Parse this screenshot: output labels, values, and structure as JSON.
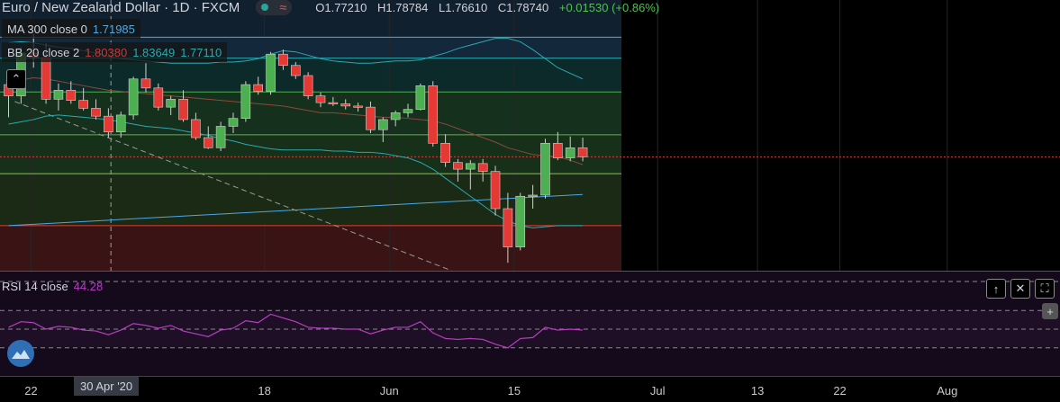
{
  "header": {
    "title": "Euro / New Zealand Dollar · 1D · FXCM",
    "ohlc": {
      "open": "O1.77210",
      "high": "H1.78784",
      "low": "L1.76610",
      "close": "C1.78740",
      "change": "+0.01530 (+0.86%)"
    },
    "flag_icon": "≈"
  },
  "indicators": {
    "ma": {
      "name": "MA 300 close 0",
      "value": "1.71985",
      "color": "#4aa8e8"
    },
    "bb": {
      "name": "BB 20 close 2",
      "upper": "1.80380",
      "middle": "1.83649",
      "lower": "1.77110",
      "colors": [
        "#c43b3b",
        "#2aa9b0",
        "#2aa9b0"
      ]
    },
    "rsi": {
      "name": "RSI 14 close",
      "value": "44.28",
      "color": "#b53fc0"
    }
  },
  "crosshair_date": "30 Apr '20",
  "chart_data": {
    "type": "candlestick",
    "candles": [
      [
        1.785,
        1.792,
        1.756,
        1.775
      ],
      [
        1.775,
        1.818,
        1.768,
        1.813
      ],
      [
        1.813,
        1.83,
        1.8,
        1.809
      ],
      [
        1.809,
        1.822,
        1.768,
        1.772
      ],
      [
        1.772,
        1.786,
        1.762,
        1.78
      ],
      [
        1.78,
        1.788,
        1.768,
        1.771
      ],
      [
        1.771,
        1.782,
        1.762,
        1.764
      ],
      [
        1.764,
        1.772,
        1.754,
        1.757
      ],
      [
        1.757,
        1.764,
        1.738,
        1.743
      ],
      [
        1.743,
        1.761,
        1.738,
        1.758
      ],
      [
        1.758,
        1.792,
        1.754,
        1.79
      ],
      [
        1.79,
        1.804,
        1.778,
        1.782
      ],
      [
        1.782,
        1.786,
        1.762,
        1.765
      ],
      [
        1.765,
        1.775,
        1.758,
        1.772
      ],
      [
        1.772,
        1.78,
        1.752,
        1.754
      ],
      [
        1.754,
        1.76,
        1.736,
        1.738
      ],
      [
        1.738,
        1.748,
        1.728,
        1.729
      ],
      [
        1.729,
        1.752,
        1.726,
        1.748
      ],
      [
        1.748,
        1.76,
        1.742,
        1.755
      ],
      [
        1.755,
        1.788,
        1.752,
        1.785
      ],
      [
        1.785,
        1.792,
        1.776,
        1.779
      ],
      [
        1.779,
        1.814,
        1.776,
        1.812
      ],
      [
        1.812,
        1.816,
        1.798,
        1.802
      ],
      [
        1.802,
        1.805,
        1.79,
        1.793
      ],
      [
        1.793,
        1.796,
        1.772,
        1.775
      ],
      [
        1.775,
        1.778,
        1.765,
        1.769
      ],
      [
        1.769,
        1.774,
        1.766,
        1.768
      ],
      [
        1.768,
        1.772,
        1.763,
        1.766
      ],
      [
        1.766,
        1.769,
        1.761,
        1.765
      ],
      [
        1.765,
        1.77,
        1.742,
        1.745
      ],
      [
        1.745,
        1.756,
        1.734,
        1.754
      ],
      [
        1.754,
        1.762,
        1.748,
        1.76
      ],
      [
        1.76,
        1.768,
        1.756,
        1.763
      ],
      [
        1.763,
        1.786,
        1.762,
        1.784
      ],
      [
        1.784,
        1.788,
        1.73,
        1.733
      ],
      [
        1.733,
        1.741,
        1.712,
        1.716
      ],
      [
        1.716,
        1.719,
        1.699,
        1.71
      ],
      [
        1.71,
        1.718,
        1.692,
        1.715
      ],
      [
        1.715,
        1.719,
        1.699,
        1.708
      ],
      [
        1.708,
        1.713,
        1.669,
        1.675
      ],
      [
        1.675,
        1.689,
        1.627,
        1.641
      ],
      [
        1.641,
        1.689,
        1.638,
        1.686
      ],
      [
        1.686,
        1.696,
        1.675,
        1.687
      ],
      [
        1.687,
        1.737,
        1.684,
        1.733
      ],
      [
        1.733,
        1.743,
        1.718,
        1.72
      ],
      [
        1.72,
        1.739,
        1.717,
        1.729
      ],
      [
        1.729,
        1.738,
        1.717,
        1.721
      ]
    ],
    "bb_upper": [
      1.822,
      1.823,
      1.822,
      1.82,
      1.818,
      1.817,
      1.815,
      1.813,
      1.81,
      1.808,
      1.807,
      1.806,
      1.805,
      1.804,
      1.804,
      1.804,
      1.804,
      1.805,
      1.805,
      1.806,
      1.808,
      1.812,
      1.815,
      1.814,
      1.811,
      1.808,
      1.806,
      1.805,
      1.804,
      1.804,
      1.805,
      1.806,
      1.806,
      1.807,
      1.81,
      1.813,
      1.817,
      1.82,
      1.823,
      1.826,
      1.826,
      1.823,
      1.816,
      1.808,
      1.8,
      1.795,
      1.79
    ],
    "bb_middle": [
      1.786,
      1.789,
      1.791,
      1.79,
      1.788,
      1.786,
      1.784,
      1.782,
      1.78,
      1.779,
      1.778,
      1.777,
      1.776,
      1.775,
      1.774,
      1.773,
      1.772,
      1.771,
      1.77,
      1.769,
      1.768,
      1.767,
      1.766,
      1.764,
      1.762,
      1.76,
      1.76,
      1.759,
      1.758,
      1.757,
      1.756,
      1.756,
      1.755,
      1.754,
      1.753,
      1.75,
      1.746,
      1.742,
      1.738,
      1.734,
      1.729,
      1.726,
      1.723,
      1.722,
      1.721,
      1.718,
      1.714
    ],
    "bb_lower": [
      1.75,
      1.752,
      1.754,
      1.757,
      1.758,
      1.757,
      1.756,
      1.755,
      1.754,
      1.752,
      1.75,
      1.748,
      1.747,
      1.746,
      1.744,
      1.742,
      1.74,
      1.737,
      1.735,
      1.732,
      1.73,
      1.728,
      1.727,
      1.727,
      1.727,
      1.727,
      1.726,
      1.726,
      1.725,
      1.725,
      1.724,
      1.722,
      1.72,
      1.716,
      1.71,
      1.702,
      1.694,
      1.686,
      1.678,
      1.67,
      1.664,
      1.66,
      1.658,
      1.659,
      1.66,
      1.66,
      1.66
    ],
    "ma300": [
      1.66,
      1.6606,
      1.6612,
      1.6618,
      1.6624,
      1.663,
      1.6636,
      1.6642,
      1.6648,
      1.6654,
      1.666,
      1.6666,
      1.6672,
      1.6678,
      1.6684,
      1.669,
      1.6696,
      1.6702,
      1.6708,
      1.6714,
      1.672,
      1.6726,
      1.6732,
      1.6738,
      1.6744,
      1.675,
      1.6756,
      1.6762,
      1.6768,
      1.6774,
      1.678,
      1.6786,
      1.6792,
      1.6798,
      1.6804,
      1.681,
      1.6816,
      1.6822,
      1.6828,
      1.6834,
      1.684,
      1.6846,
      1.6852,
      1.6858,
      1.6864,
      1.687,
      1.6876
    ],
    "rsi": [
      52,
      58,
      57,
      50,
      53,
      52,
      49,
      48,
      44,
      49,
      56,
      54,
      51,
      54,
      48,
      45,
      42,
      49,
      51,
      59,
      57,
      66,
      62,
      58,
      52,
      51,
      51,
      50,
      50,
      45,
      49,
      52,
      52,
      58,
      46,
      40,
      39,
      40,
      39,
      34,
      30,
      40,
      41,
      52,
      49,
      50,
      49
    ],
    "x_ticks": [
      {
        "label": "22",
        "index": 1.8
      },
      {
        "label": "18",
        "index": 20.5
      },
      {
        "label": "Jun",
        "index": 30.5
      },
      {
        "label": "15",
        "index": 40.5
      },
      {
        "label": "Jul",
        "index": 52.0
      },
      {
        "label": "13",
        "index": 60.0
      },
      {
        "label": "22",
        "index": 66.6
      },
      {
        "label": "Aug",
        "index": 75.2
      }
    ],
    "crosshair_index": 8.2,
    "price_levels": [
      1.827,
      1.8085,
      1.7785,
      1.7405,
      1.706,
      1.66
    ],
    "current_price": 1.721,
    "y_range": [
      1.62,
      1.86
    ],
    "rsi_range": [
      0,
      100
    ],
    "rsi_levels": [
      70,
      50,
      30
    ],
    "bull_color": "#4caf50",
    "bear_color": "#e53935"
  }
}
